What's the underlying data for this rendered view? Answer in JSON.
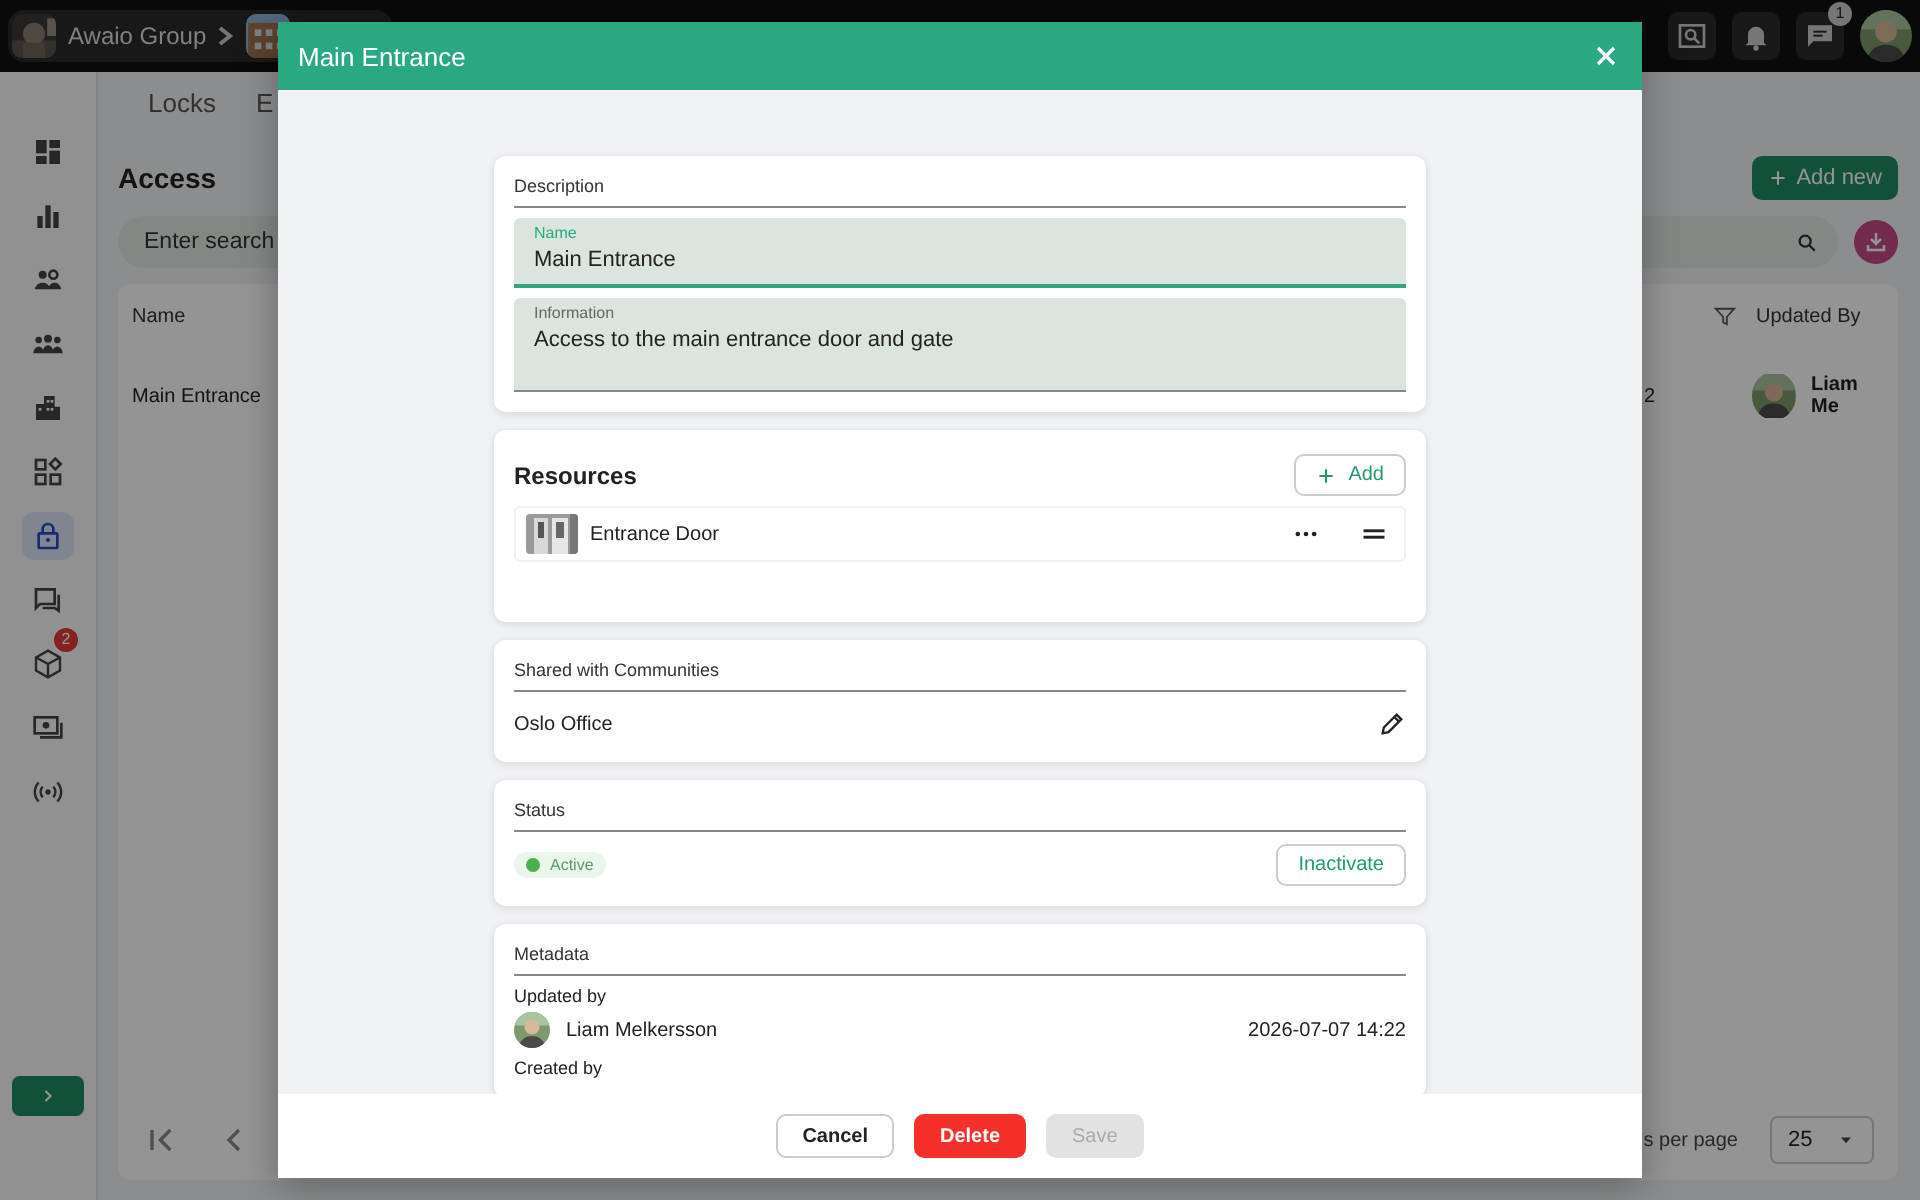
{
  "top_bar": {
    "breadcrumb": [
      {
        "label": "Awaio Group"
      },
      {
        "kind": "picture"
      }
    ],
    "icons": [
      {
        "kind": "scan"
      },
      {
        "kind": "bell"
      },
      {
        "kind": "chat",
        "badge": "1"
      }
    ]
  },
  "sidebar": {
    "items": [
      {
        "kind": "dashboard",
        "selected": false
      },
      {
        "kind": "chart",
        "selected": false
      },
      {
        "kind": "people",
        "selected": false
      },
      {
        "kind": "group",
        "selected": false
      },
      {
        "kind": "building",
        "selected": false
      },
      {
        "kind": "apps",
        "selected": false
      },
      {
        "kind": "lock",
        "selected": true
      },
      {
        "kind": "chat",
        "selected": false
      },
      {
        "kind": "cube",
        "selected": false,
        "badge": "2"
      },
      {
        "kind": "money",
        "selected": false
      },
      {
        "kind": "signal",
        "selected": false
      }
    ]
  },
  "tabs": [
    {
      "label": "Locks",
      "selected": false
    },
    {
      "label": "E",
      "selected": false
    }
  ],
  "page": {
    "title": "Access",
    "add_button": "Add new",
    "search": {
      "placeholder": "Enter search"
    }
  },
  "table": {
    "columns": [
      {
        "label": "Name"
      },
      {
        "label": "Updated By"
      }
    ],
    "rows": [
      {
        "name": "Main Entrance",
        "column_2": "2",
        "updated_by": "Liam Me"
      }
    ],
    "rows_per_page_label": "s per page",
    "rows_per_page": "25"
  },
  "dialog": {
    "title": "Main Entrance",
    "description": {
      "label": "Description",
      "fields": [
        {
          "label": "Name",
          "value": "Main Entrance",
          "focused": true
        },
        {
          "label": "Information",
          "value": "Access to the main entrance door and gate",
          "focused": false
        }
      ]
    },
    "resources": {
      "title": "Resources",
      "add_button": "Add",
      "items": [
        {
          "name": "Entrance Door"
        }
      ]
    },
    "shared": {
      "label": "Shared with Communities",
      "items": [
        {
          "name": "Oslo Office"
        }
      ]
    },
    "status": {
      "label": "Status",
      "active": true,
      "chip": "Active",
      "button": "Inactivate"
    },
    "metadata": {
      "label": "Metadata",
      "updated_label": "Updated by",
      "updated_by": "Liam Melkersson",
      "updated_at": "2026-07-07 14:22",
      "created_label": "Created by"
    },
    "buttons": [
      {
        "label": "Cancel",
        "kind": "cancel",
        "disabled": false
      },
      {
        "label": "Delete",
        "kind": "delete",
        "disabled": false
      },
      {
        "label": "Save",
        "kind": "save",
        "disabled": true
      }
    ]
  }
}
